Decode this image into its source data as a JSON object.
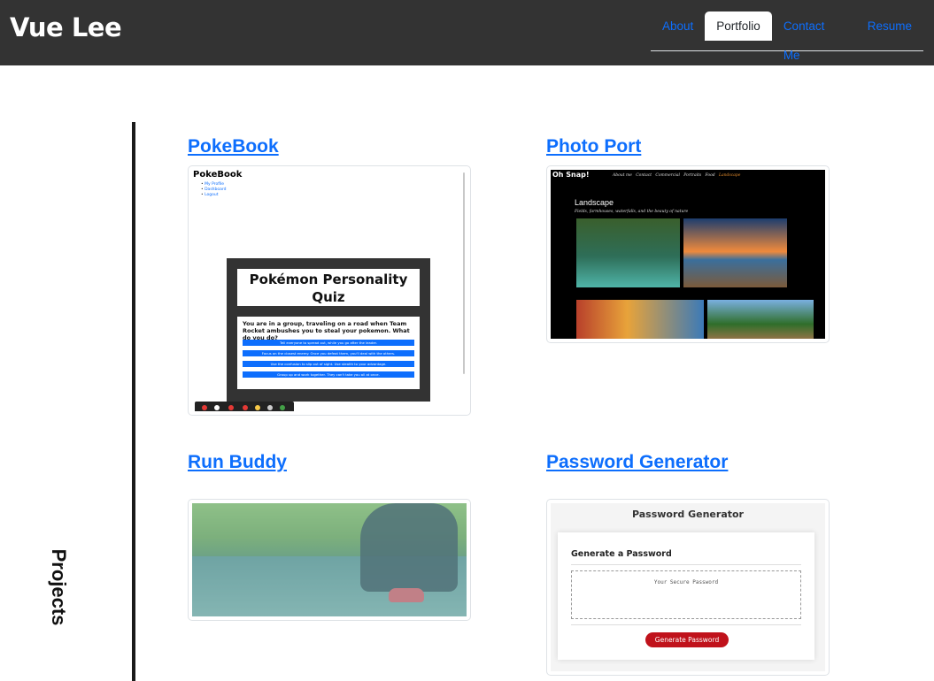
{
  "header": {
    "brand": "Vue Lee",
    "tabs": [
      {
        "label": "About",
        "active": false
      },
      {
        "label": "Portfolio",
        "active": true
      },
      {
        "label": "Contact Me",
        "active": false
      },
      {
        "label": "Resume",
        "active": false
      }
    ]
  },
  "section": {
    "label": "Projects"
  },
  "projects": [
    {
      "title": "PokeBook",
      "preview": {
        "app_title": "PokeBook",
        "links": [
          "My Profile",
          "Dashboard",
          "Logout"
        ],
        "quiz_title": "Pokémon Personality Quiz",
        "question": "You are in a group, traveling on a road when Team Rocket ambushes you to steal your pokemon. What do you do?",
        "options": [
          "Tell everyone to spread out, while you go after the leader.",
          "Focus on the closest enemy. Once you defeat them, you'll deal with the others.",
          "Use the confusion to slip out of sight. Use stealth to your advantage.",
          "Group up and work together. They can't take you all at once."
        ]
      }
    },
    {
      "title": "Photo Port",
      "preview": {
        "brand": "Oh Snap!",
        "nav": [
          "About me",
          "Contact",
          "Commercial",
          "Portraits",
          "Food",
          "Landscape"
        ],
        "heading": "Landscape",
        "subheading": "Fields, farmhouses, waterfalls, and the beauty of nature"
      }
    },
    {
      "title": "Run Buddy"
    },
    {
      "title": "Password Generator",
      "preview": {
        "page_title": "Password Generator",
        "card_title": "Generate a Password",
        "placeholder": "Your Secure Password",
        "button_label": "Generate Password"
      }
    }
  ],
  "colors": {
    "navbar": "#333333",
    "link": "#0d6efd",
    "generate_button": "#c0121b"
  }
}
